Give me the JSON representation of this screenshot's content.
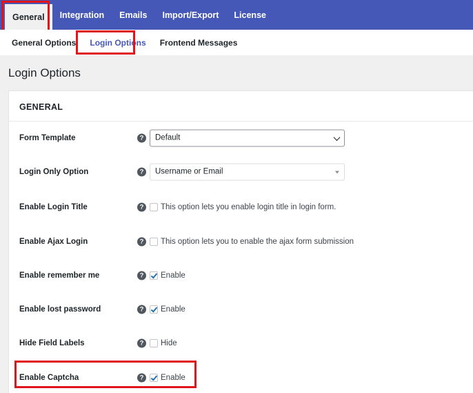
{
  "top_nav": {
    "tabs": [
      {
        "label": "General",
        "active": true
      },
      {
        "label": "Integration"
      },
      {
        "label": "Emails"
      },
      {
        "label": "Import/Export"
      },
      {
        "label": "License"
      }
    ]
  },
  "sub_nav": {
    "tabs": [
      {
        "label": "General Options"
      },
      {
        "label": "Login Options",
        "active": true
      },
      {
        "label": "Frontend Messages"
      }
    ]
  },
  "page": {
    "title": "Login Options",
    "section_title": "GENERAL"
  },
  "fields": {
    "form_template": {
      "label": "Form Template",
      "value": "Default"
    },
    "login_only_option": {
      "label": "Login Only Option",
      "value": "Username or Email"
    },
    "enable_login_title": {
      "label": "Enable Login Title",
      "checked": false,
      "text": "This option lets you enable login title in login form."
    },
    "enable_ajax_login": {
      "label": "Enable Ajax Login",
      "checked": false,
      "text": "This option lets you to enable the ajax form submission"
    },
    "enable_remember_me": {
      "label": "Enable remember me",
      "checked": true,
      "text": "Enable"
    },
    "enable_lost_password": {
      "label": "Enable lost password",
      "checked": true,
      "text": "Enable"
    },
    "hide_field_labels": {
      "label": "Hide Field Labels",
      "checked": false,
      "text": "Hide"
    },
    "enable_captcha": {
      "label": "Enable Captcha",
      "checked": true,
      "text": "Enable"
    }
  },
  "help_icon_glyph": "?",
  "colors": {
    "nav_bg": "#4558b8",
    "highlight": "#e0141b",
    "checkmark": "#2271b1"
  }
}
